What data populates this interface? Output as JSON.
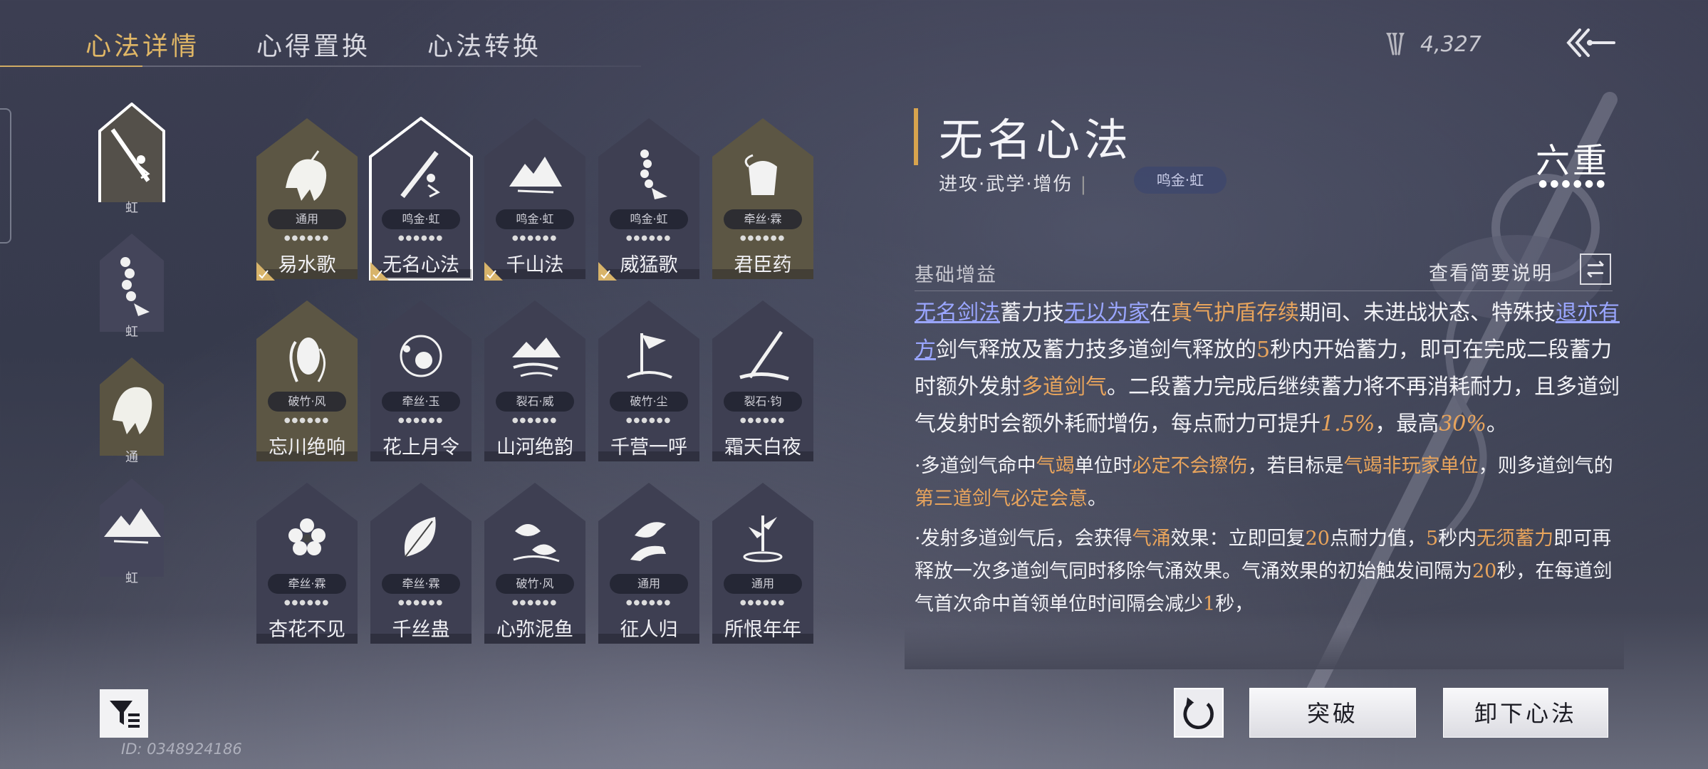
{
  "tabs": [
    {
      "label": "心法详情",
      "active": true
    },
    {
      "label": "心得置换",
      "active": false
    },
    {
      "label": "心法转换",
      "active": false
    }
  ],
  "currency": {
    "icon": "arrows-icon",
    "value": "4,327"
  },
  "equipped": [
    {
      "label": "虹",
      "icon": "sword-icon",
      "selected": true
    },
    {
      "label": "虹",
      "icon": "bead-bracelet-icon",
      "selected": false
    },
    {
      "label": "通",
      "icon": "beast-icon",
      "selected": false
    },
    {
      "label": "虹",
      "icon": "mountain-icon",
      "selected": false
    }
  ],
  "cards": [
    {
      "name": "易水歌",
      "badge": "通用",
      "icon": "beast-icon",
      "gold": true,
      "checked": true,
      "selected": false
    },
    {
      "name": "无名心法",
      "badge": "鸣金·虹",
      "icon": "sword-icon",
      "gold": false,
      "checked": true,
      "selected": true
    },
    {
      "name": "千山法",
      "badge": "鸣金·虹",
      "icon": "mountain-icon",
      "gold": false,
      "checked": true,
      "selected": false
    },
    {
      "name": "威猛歌",
      "badge": "鸣金·虹",
      "icon": "bead-bracelet-icon",
      "gold": false,
      "checked": true,
      "selected": false
    },
    {
      "name": "君臣药",
      "badge": "牵丝·霖",
      "icon": "herb-jar-icon",
      "gold": true,
      "checked": false,
      "selected": false
    },
    {
      "name": "忘川绝响",
      "badge": "破竹·风",
      "icon": "ghost-face-icon",
      "gold": true,
      "checked": false,
      "selected": false
    },
    {
      "name": "花上月令",
      "badge": "牵丝·玉",
      "icon": "flower-moon-icon",
      "gold": false,
      "checked": false,
      "selected": false
    },
    {
      "name": "山河绝韵",
      "badge": "裂石·威",
      "icon": "river-mountain-icon",
      "gold": false,
      "checked": false,
      "selected": false
    },
    {
      "name": "千营一呼",
      "badge": "破竹·尘",
      "icon": "flag-icon",
      "gold": false,
      "checked": false,
      "selected": false
    },
    {
      "name": "霜天白夜",
      "badge": "裂石·钧",
      "icon": "spear-icon",
      "gold": false,
      "checked": false,
      "selected": false
    },
    {
      "name": "杏花不见",
      "badge": "牵丝·霖",
      "icon": "blossom-icon",
      "gold": false,
      "checked": false,
      "selected": false
    },
    {
      "name": "千丝蛊",
      "badge": "牵丝·霖",
      "icon": "leaf-icon",
      "gold": false,
      "checked": false,
      "selected": false
    },
    {
      "name": "心弥泥鱼",
      "badge": "破竹·风",
      "icon": "fish-icon",
      "gold": false,
      "checked": false,
      "selected": false
    },
    {
      "name": "征人归",
      "badge": "通用",
      "icon": "bird-hand-icon",
      "gold": false,
      "checked": false,
      "selected": false
    },
    {
      "name": "所恨年年",
      "badge": "通用",
      "icon": "bamboo-icon",
      "gold": false,
      "checked": false,
      "selected": false
    }
  ],
  "detail": {
    "title": "无名心法",
    "subtitle": "进攻·武学·增伤",
    "subtitle_sep": "|",
    "tag": "鸣金·虹",
    "tier": "六重",
    "tier_dots": "●●●●●●",
    "section_label": "基础增益",
    "brief_link": "查看简要说明",
    "p1": [
      {
        "t": "无名剑法",
        "c": "lk"
      },
      {
        "t": "蓄力技",
        "c": ""
      },
      {
        "t": "无以为家",
        "c": "lk"
      },
      {
        "t": "在",
        "c": ""
      },
      {
        "t": "真气护盾存续",
        "c": "hl"
      },
      {
        "t": "期间、未进战状态、特殊技",
        "c": ""
      },
      {
        "t": "退亦有方",
        "c": "lk"
      },
      {
        "t": "剑气释放及蓄力技多道剑气释放的",
        "c": ""
      },
      {
        "t": "5",
        "c": "hl"
      },
      {
        "t": "秒内开始蓄力，即可在完成二段蓄力时额外发射",
        "c": ""
      },
      {
        "t": "多道剑气",
        "c": "hl"
      },
      {
        "t": "。二段蓄力完成后继续蓄力将不再消耗耐力，且多道剑气发射时会额外耗耐增伤，每点耐力可提升",
        "c": ""
      },
      {
        "t": "1.5%",
        "c": "nm"
      },
      {
        "t": "，最高",
        "c": ""
      },
      {
        "t": "30%",
        "c": "nm"
      },
      {
        "t": "。",
        "c": ""
      }
    ],
    "p2": [
      {
        "t": "·多道剑气命中",
        "c": ""
      },
      {
        "t": "气竭",
        "c": "hl"
      },
      {
        "t": "单位时",
        "c": ""
      },
      {
        "t": "必定不会擦伤",
        "c": "hl"
      },
      {
        "t": "，若目标是",
        "c": ""
      },
      {
        "t": "气竭非玩家单位",
        "c": "hl"
      },
      {
        "t": "，则多道剑气的",
        "c": ""
      },
      {
        "t": "第三道剑气必定会意",
        "c": "hl"
      },
      {
        "t": "。",
        "c": ""
      }
    ],
    "p3": [
      {
        "t": "·发射多道剑气后，会获得",
        "c": ""
      },
      {
        "t": "气涌",
        "c": "hl"
      },
      {
        "t": "效果：立即回复",
        "c": ""
      },
      {
        "t": "20",
        "c": "hl"
      },
      {
        "t": "点耐力值，",
        "c": ""
      },
      {
        "t": "5",
        "c": "hl"
      },
      {
        "t": "秒内",
        "c": ""
      },
      {
        "t": "无须蓄力",
        "c": "hl"
      },
      {
        "t": "即可再释放一次多道剑气同时移除气涌效果。气涌效果的初始触发间隔为",
        "c": ""
      },
      {
        "t": "20",
        "c": "hl"
      },
      {
        "t": "秒，在每道剑气首次命中首领单位时间隔会减少",
        "c": ""
      },
      {
        "t": "1",
        "c": "hl"
      },
      {
        "t": "秒，",
        "c": ""
      }
    ]
  },
  "buttons": {
    "breakthrough": "突破",
    "unequip": "卸下心法"
  },
  "player_id": "ID: 0348924186",
  "colors": {
    "accent_gold": "#e0b766",
    "highlight_orange": "#e8a45c",
    "link_blue": "#9aa6ff"
  }
}
